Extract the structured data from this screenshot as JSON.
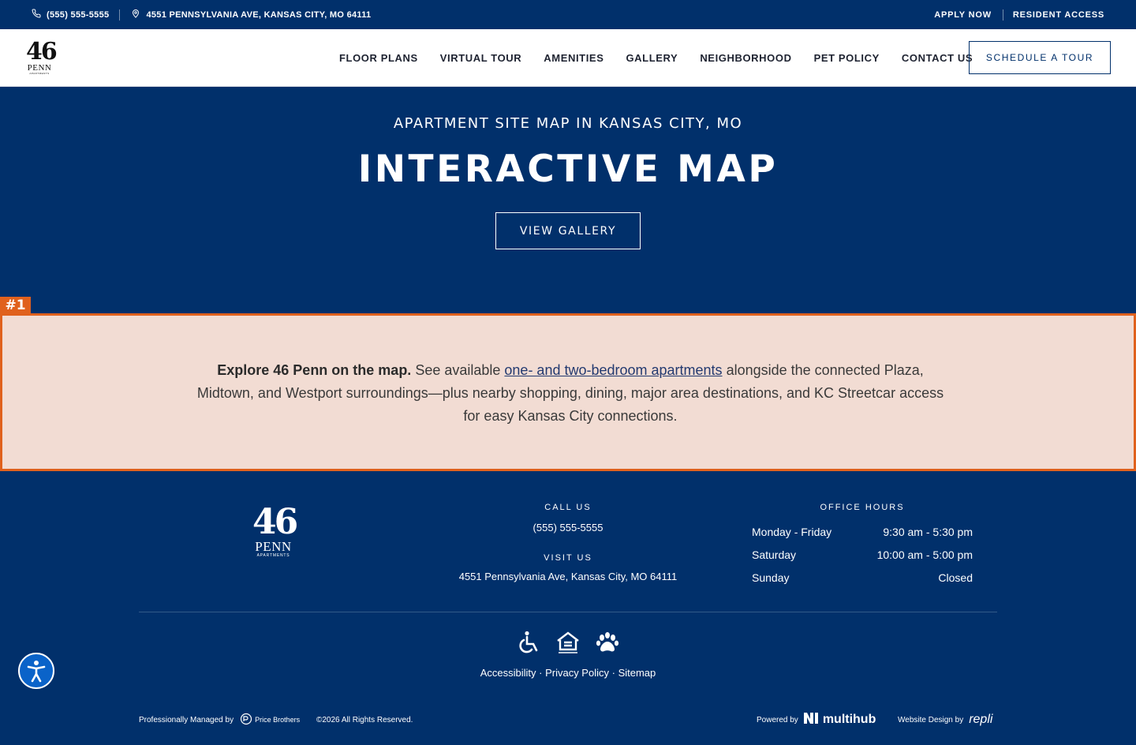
{
  "topbar": {
    "phone": "(555) 555-5555",
    "address": "4551 PENNSYLVANIA AVE, KANSAS CITY, MO 64111",
    "apply": "APPLY NOW",
    "resident": "RESIDENT ACCESS"
  },
  "logo": {
    "number": "46",
    "word": "PENN",
    "sub": "APARTMENTS"
  },
  "nav": {
    "items": [
      "FLOOR PLANS",
      "VIRTUAL TOUR",
      "AMENITIES",
      "GALLERY",
      "NEIGHBORHOOD",
      "PET POLICY",
      "CONTACT US"
    ],
    "tour_button": "SCHEDULE A TOUR"
  },
  "hero": {
    "eyebrow": "APARTMENT SITE MAP IN KANSAS CITY, MO",
    "title": "INTERACTIVE MAP",
    "button": "VIEW GALLERY"
  },
  "highlight": {
    "tag": "#1",
    "lead": "Explore 46 Penn on the map.",
    "text_before": " See available ",
    "link": "one- and two-bedroom apartments",
    "text_after": " alongside the connected Plaza, Midtown, and Westport surroundings—plus nearby shopping, dining, major area destinations, and KC Streetcar access for easy Kansas City connections."
  },
  "footer": {
    "call_label": "CALL US",
    "phone": "(555) 555-5555",
    "visit_label": "VISIT US",
    "address": "4551 Pennsylvania Ave, Kansas City, MO 64111",
    "hours_label": "OFFICE HOURS",
    "hours": [
      {
        "day": "Monday - Friday",
        "time": "9:30 am - 5:30 pm"
      },
      {
        "day": "Saturday",
        "time": "10:00 am - 5:00 pm"
      },
      {
        "day": "Sunday",
        "time": "Closed"
      }
    ],
    "legal_links": [
      "Accessibility",
      "Privacy Policy",
      "Sitemap"
    ],
    "legal_separator": " · ",
    "managed_by": "Professionally Managed by",
    "manager_name": "Price Brothers",
    "copyright": "©2026 All Rights Reserved.",
    "powered_by": "Powered by",
    "powered_brand": "multihub",
    "design_by": "Website Design by",
    "design_brand": "repli"
  },
  "icons": [
    "phone-icon",
    "map-pin-icon",
    "wheelchair-icon",
    "equal-housing-icon",
    "paw-icon",
    "accessibility-icon"
  ],
  "colors": {
    "navy": "#01306b",
    "accent": "#e0611d",
    "highlight_bg": "#f2dcd3",
    "link": "#233a70"
  }
}
